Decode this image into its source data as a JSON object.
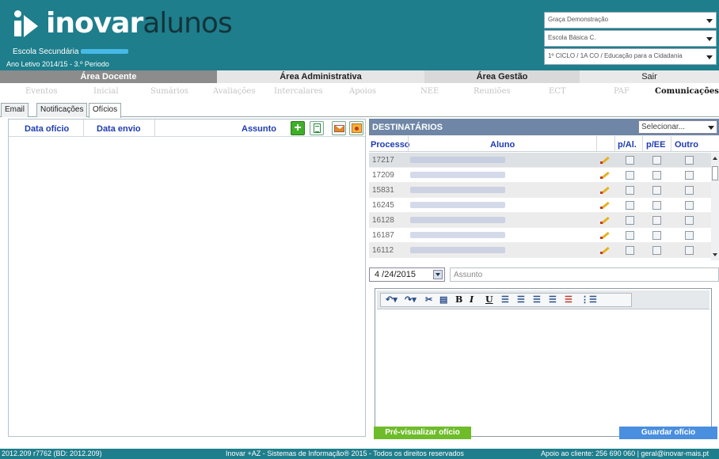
{
  "header": {
    "logo_main": "inovar",
    "logo_sub": "alunos",
    "school_label": "Escola Secundária",
    "period": "Ano Letivo 2014/15 - 3.º Periodo",
    "selectors": [
      "Graça Demonstração",
      "Escola Básica C.",
      "1º CICLO / 1A CO / Educação para a Cidadania"
    ]
  },
  "mainmenu": [
    "Área Docente",
    "Área Administrativa",
    "Área Gestão",
    "Sair"
  ],
  "submenu": [
    "Eventos",
    "Inicial",
    "Sumários",
    "Avaliações",
    "Intercalares",
    "Apoios",
    "NEE",
    "Reuniões",
    "ECT",
    "PAF",
    "Comunicações"
  ],
  "tabs": [
    "Email",
    "Notificações",
    "Ofícios"
  ],
  "left": {
    "col_data_oficio": "Data ofício",
    "col_data_envio": "Data envio",
    "col_assunto": "Assunto"
  },
  "right": {
    "title": "DESTINATÁRIOS",
    "select_placeholder": "Selecionar...",
    "col_processo": "Processo",
    "col_aluno": "Aluno",
    "col_pal": "p/Al.",
    "col_pee": "p/EE",
    "col_outro": "Outro",
    "rows": [
      {
        "processo": "17217"
      },
      {
        "processo": "17209"
      },
      {
        "processo": "15831"
      },
      {
        "processo": "16245"
      },
      {
        "processo": "16128"
      },
      {
        "processo": "16187"
      },
      {
        "processo": "16112"
      }
    ]
  },
  "form": {
    "date": "4 /24/2015",
    "assunto_placeholder": "Assunto"
  },
  "buttons": {
    "preview": "Pré-visualizar ofício",
    "save": "Guardar ofício"
  },
  "footer": {
    "version": "2012.209 r7762 (BD: 2012.209)",
    "copyright": "Inovar +AZ - Sistemas de Informação® 2015 - Todos os direitos reservados",
    "support": "Apoio ao cliente: 256 690 060 | geral@inovar-mais.pt"
  },
  "colors": {
    "header": "#1e7e8c",
    "accent_blue": "#1f3bb3",
    "preview_button": "#6ebc2a",
    "save_button": "#4a8ee0"
  }
}
